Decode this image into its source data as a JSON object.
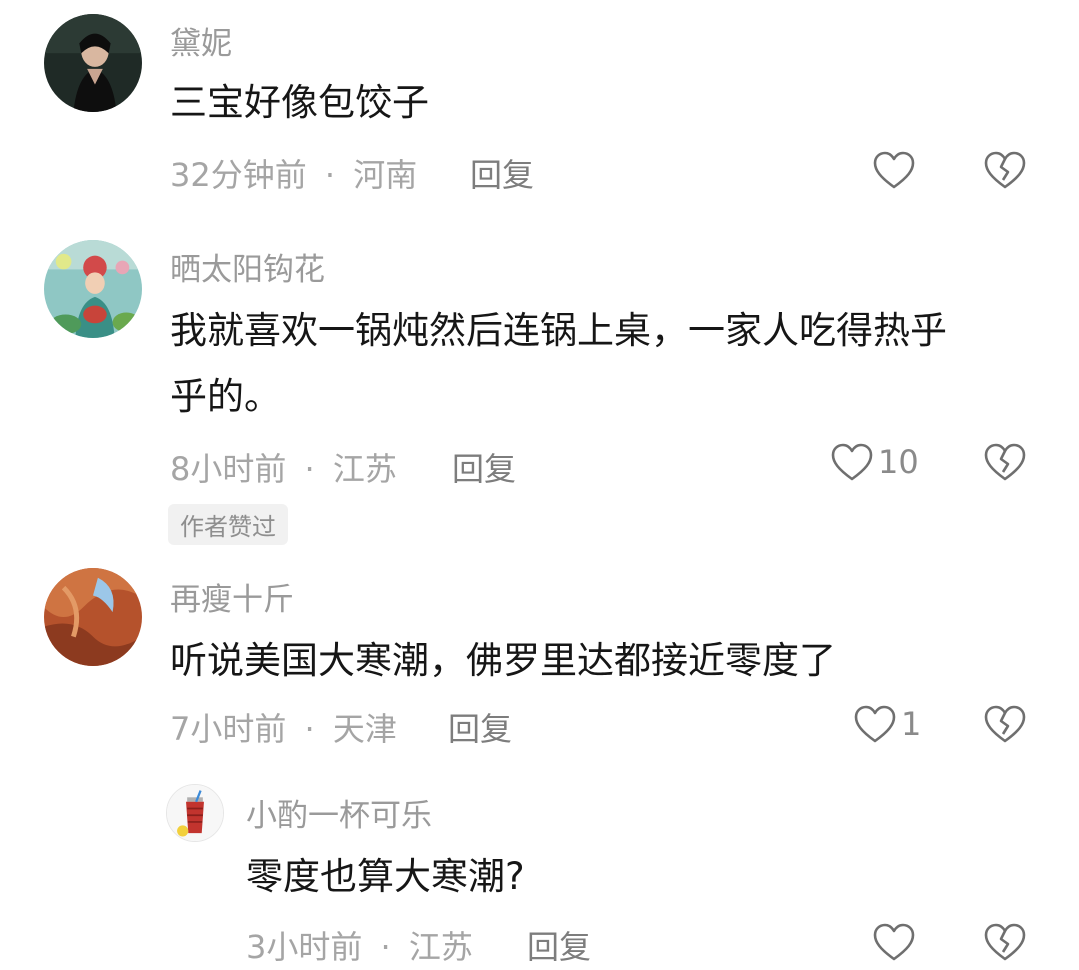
{
  "comments": [
    {
      "username": "黛妮",
      "text": "三宝好像包饺子",
      "time": "32分钟前",
      "location": "河南",
      "reply_label": "回复",
      "likes": ""
    },
    {
      "username": "晒太阳钩花",
      "text_line1": "我就喜欢一锅炖然后连锅上桌，一家人吃得热乎",
      "text_line2": "乎的。",
      "time": "8小时前",
      "location": "江苏",
      "reply_label": "回复",
      "likes": "10",
      "badge": "作者赞过"
    },
    {
      "username": "再瘦十斤",
      "text": "听说美国大寒潮，佛罗里达都接近零度了",
      "time": "7小时前",
      "location": "天津",
      "reply_label": "回复",
      "likes": "1"
    },
    {
      "username": "小酌一杯可乐",
      "text": "零度也算大寒潮?",
      "time": "3小时前",
      "location": "江苏",
      "reply_label": "回复",
      "likes": ""
    }
  ],
  "meta_separator": "·",
  "icons": {
    "like": "heart-outline-icon",
    "dislike": "broken-heart-icon"
  },
  "colors": {
    "text": "#161616",
    "muted": "#a5a5a5",
    "reply": "#7d7d7d",
    "icon": "#6f6f6f"
  }
}
